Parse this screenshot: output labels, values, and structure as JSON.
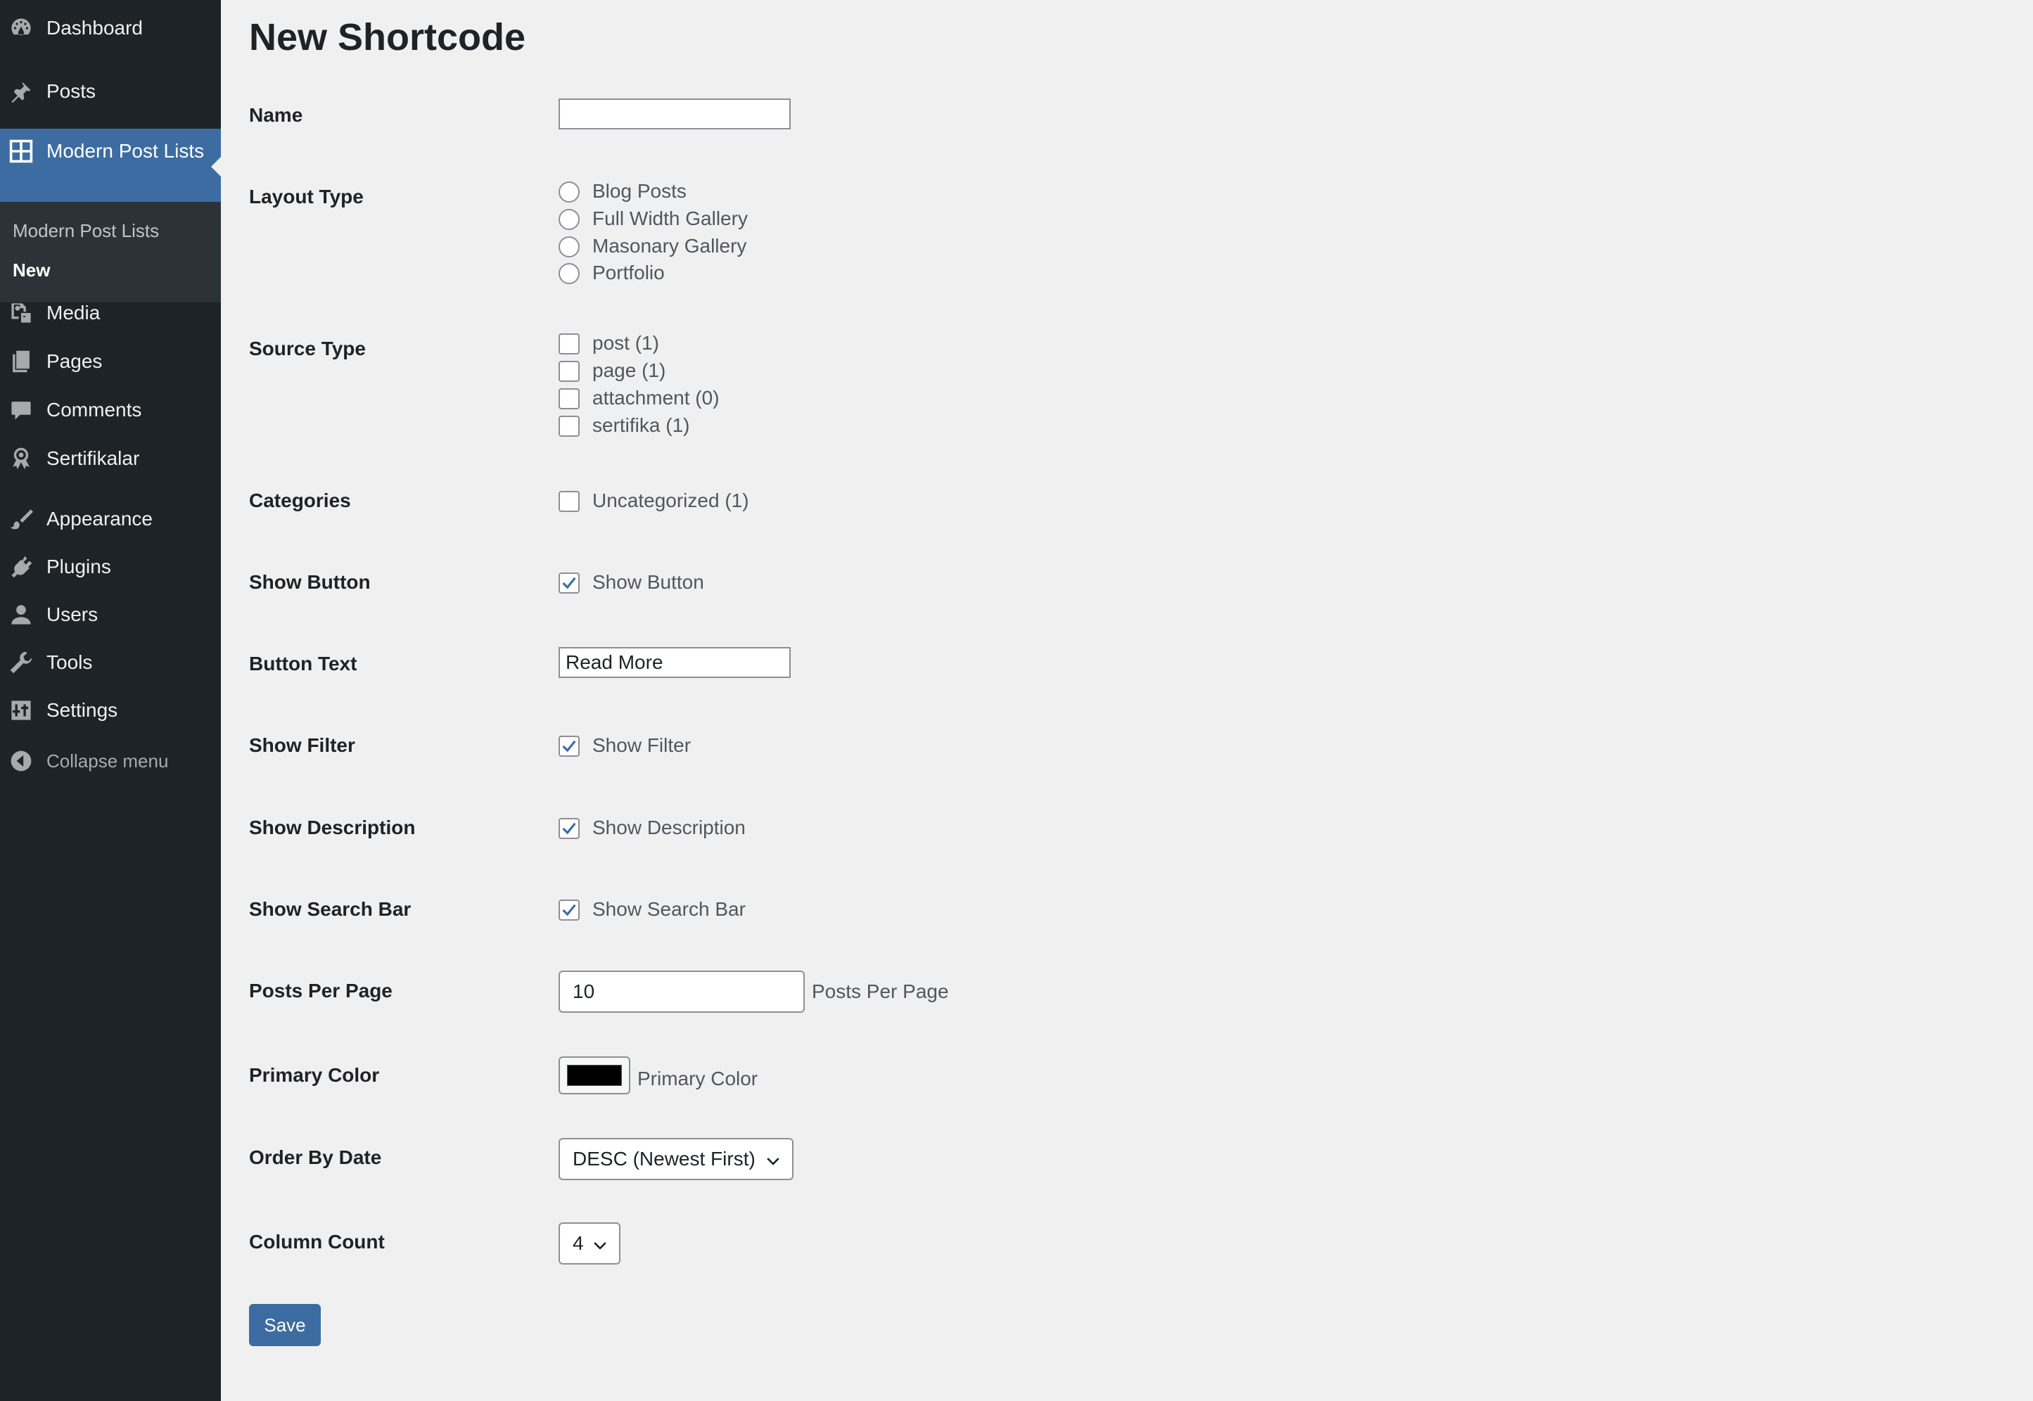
{
  "sidebar": {
    "items": [
      {
        "label": "Dashboard",
        "icon": "dashboard-icon"
      },
      {
        "label": "Posts",
        "icon": "pin-icon"
      },
      {
        "label": "Modern Post Lists",
        "icon": "grid-icon"
      },
      {
        "label": "Media",
        "icon": "media-icon"
      },
      {
        "label": "Pages",
        "icon": "pages-icon"
      },
      {
        "label": "Comments",
        "icon": "comment-icon"
      },
      {
        "label": "Sertifikalar",
        "icon": "award-icon"
      },
      {
        "label": "Appearance",
        "icon": "brush-icon"
      },
      {
        "label": "Plugins",
        "icon": "plugin-icon"
      },
      {
        "label": "Users",
        "icon": "user-icon"
      },
      {
        "label": "Tools",
        "icon": "wrench-icon"
      },
      {
        "label": "Settings",
        "icon": "settings-icon"
      },
      {
        "label": "Collapse menu",
        "icon": "collapse-icon"
      }
    ],
    "submenu": [
      {
        "label": "Modern Post Lists"
      },
      {
        "label": "New"
      }
    ],
    "active_color": "#3d6ca3",
    "bg_color": "#1d2327"
  },
  "page": {
    "title": "New Shortcode"
  },
  "form": {
    "name": {
      "label": "Name",
      "value": ""
    },
    "layout_type": {
      "label": "Layout Type",
      "options": [
        "Blog Posts",
        "Full Width Gallery",
        "Masonary Gallery",
        "Portfolio"
      ]
    },
    "source_type": {
      "label": "Source Type",
      "options": [
        "post (1)",
        "page (1)",
        "attachment (0)",
        "sertifika (1)"
      ]
    },
    "categories": {
      "label": "Categories",
      "options": [
        "Uncategorized (1)"
      ]
    },
    "show_button": {
      "label": "Show Button",
      "option": "Show Button",
      "checked": true
    },
    "button_text": {
      "label": "Button Text",
      "value": "Read More"
    },
    "show_filter": {
      "label": "Show Filter",
      "option": "Show Filter",
      "checked": true
    },
    "show_description": {
      "label": "Show Description",
      "option": "Show Description",
      "checked": true
    },
    "show_search_bar": {
      "label": "Show Search Bar",
      "option": "Show Search Bar",
      "checked": true
    },
    "posts_per_page": {
      "label": "Posts Per Page",
      "value": "10",
      "suffix": "Posts Per Page"
    },
    "primary_color": {
      "label": "Primary Color",
      "value": "#000000",
      "suffix": "Primary Color"
    },
    "order_by_date": {
      "label": "Order By Date",
      "selected": "DESC (Newest First)"
    },
    "column_count": {
      "label": "Column Count",
      "selected": "4"
    },
    "save_label": "Save"
  }
}
